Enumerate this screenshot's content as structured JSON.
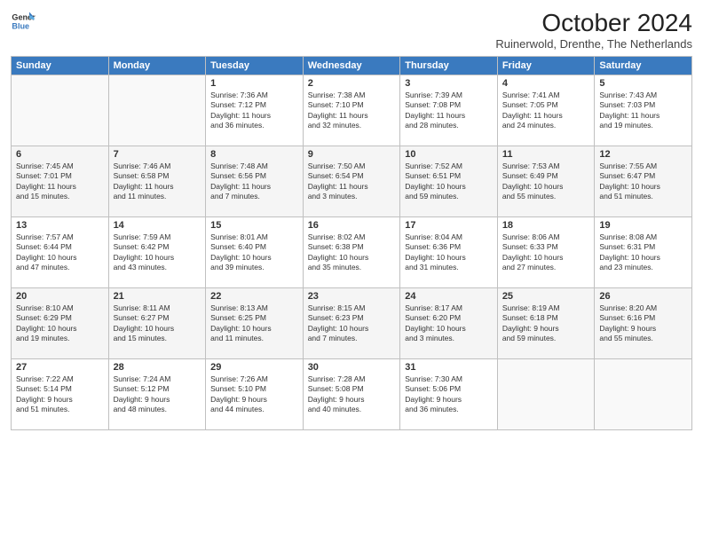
{
  "logo": {
    "line1": "General",
    "line2": "Blue"
  },
  "title": "October 2024",
  "subtitle": "Ruinerwold, Drenthe, The Netherlands",
  "headers": [
    "Sunday",
    "Monday",
    "Tuesday",
    "Wednesday",
    "Thursday",
    "Friday",
    "Saturday"
  ],
  "rows": [
    [
      {
        "day": "",
        "text": ""
      },
      {
        "day": "",
        "text": ""
      },
      {
        "day": "1",
        "text": "Sunrise: 7:36 AM\nSunset: 7:12 PM\nDaylight: 11 hours\nand 36 minutes."
      },
      {
        "day": "2",
        "text": "Sunrise: 7:38 AM\nSunset: 7:10 PM\nDaylight: 11 hours\nand 32 minutes."
      },
      {
        "day": "3",
        "text": "Sunrise: 7:39 AM\nSunset: 7:08 PM\nDaylight: 11 hours\nand 28 minutes."
      },
      {
        "day": "4",
        "text": "Sunrise: 7:41 AM\nSunset: 7:05 PM\nDaylight: 11 hours\nand 24 minutes."
      },
      {
        "day": "5",
        "text": "Sunrise: 7:43 AM\nSunset: 7:03 PM\nDaylight: 11 hours\nand 19 minutes."
      }
    ],
    [
      {
        "day": "6",
        "text": "Sunrise: 7:45 AM\nSunset: 7:01 PM\nDaylight: 11 hours\nand 15 minutes."
      },
      {
        "day": "7",
        "text": "Sunrise: 7:46 AM\nSunset: 6:58 PM\nDaylight: 11 hours\nand 11 minutes."
      },
      {
        "day": "8",
        "text": "Sunrise: 7:48 AM\nSunset: 6:56 PM\nDaylight: 11 hours\nand 7 minutes."
      },
      {
        "day": "9",
        "text": "Sunrise: 7:50 AM\nSunset: 6:54 PM\nDaylight: 11 hours\nand 3 minutes."
      },
      {
        "day": "10",
        "text": "Sunrise: 7:52 AM\nSunset: 6:51 PM\nDaylight: 10 hours\nand 59 minutes."
      },
      {
        "day": "11",
        "text": "Sunrise: 7:53 AM\nSunset: 6:49 PM\nDaylight: 10 hours\nand 55 minutes."
      },
      {
        "day": "12",
        "text": "Sunrise: 7:55 AM\nSunset: 6:47 PM\nDaylight: 10 hours\nand 51 minutes."
      }
    ],
    [
      {
        "day": "13",
        "text": "Sunrise: 7:57 AM\nSunset: 6:44 PM\nDaylight: 10 hours\nand 47 minutes."
      },
      {
        "day": "14",
        "text": "Sunrise: 7:59 AM\nSunset: 6:42 PM\nDaylight: 10 hours\nand 43 minutes."
      },
      {
        "day": "15",
        "text": "Sunrise: 8:01 AM\nSunset: 6:40 PM\nDaylight: 10 hours\nand 39 minutes."
      },
      {
        "day": "16",
        "text": "Sunrise: 8:02 AM\nSunset: 6:38 PM\nDaylight: 10 hours\nand 35 minutes."
      },
      {
        "day": "17",
        "text": "Sunrise: 8:04 AM\nSunset: 6:36 PM\nDaylight: 10 hours\nand 31 minutes."
      },
      {
        "day": "18",
        "text": "Sunrise: 8:06 AM\nSunset: 6:33 PM\nDaylight: 10 hours\nand 27 minutes."
      },
      {
        "day": "19",
        "text": "Sunrise: 8:08 AM\nSunset: 6:31 PM\nDaylight: 10 hours\nand 23 minutes."
      }
    ],
    [
      {
        "day": "20",
        "text": "Sunrise: 8:10 AM\nSunset: 6:29 PM\nDaylight: 10 hours\nand 19 minutes."
      },
      {
        "day": "21",
        "text": "Sunrise: 8:11 AM\nSunset: 6:27 PM\nDaylight: 10 hours\nand 15 minutes."
      },
      {
        "day": "22",
        "text": "Sunrise: 8:13 AM\nSunset: 6:25 PM\nDaylight: 10 hours\nand 11 minutes."
      },
      {
        "day": "23",
        "text": "Sunrise: 8:15 AM\nSunset: 6:23 PM\nDaylight: 10 hours\nand 7 minutes."
      },
      {
        "day": "24",
        "text": "Sunrise: 8:17 AM\nSunset: 6:20 PM\nDaylight: 10 hours\nand 3 minutes."
      },
      {
        "day": "25",
        "text": "Sunrise: 8:19 AM\nSunset: 6:18 PM\nDaylight: 9 hours\nand 59 minutes."
      },
      {
        "day": "26",
        "text": "Sunrise: 8:20 AM\nSunset: 6:16 PM\nDaylight: 9 hours\nand 55 minutes."
      }
    ],
    [
      {
        "day": "27",
        "text": "Sunrise: 7:22 AM\nSunset: 5:14 PM\nDaylight: 9 hours\nand 51 minutes."
      },
      {
        "day": "28",
        "text": "Sunrise: 7:24 AM\nSunset: 5:12 PM\nDaylight: 9 hours\nand 48 minutes."
      },
      {
        "day": "29",
        "text": "Sunrise: 7:26 AM\nSunset: 5:10 PM\nDaylight: 9 hours\nand 44 minutes."
      },
      {
        "day": "30",
        "text": "Sunrise: 7:28 AM\nSunset: 5:08 PM\nDaylight: 9 hours\nand 40 minutes."
      },
      {
        "day": "31",
        "text": "Sunrise: 7:30 AM\nSunset: 5:06 PM\nDaylight: 9 hours\nand 36 minutes."
      },
      {
        "day": "",
        "text": ""
      },
      {
        "day": "",
        "text": ""
      }
    ]
  ]
}
